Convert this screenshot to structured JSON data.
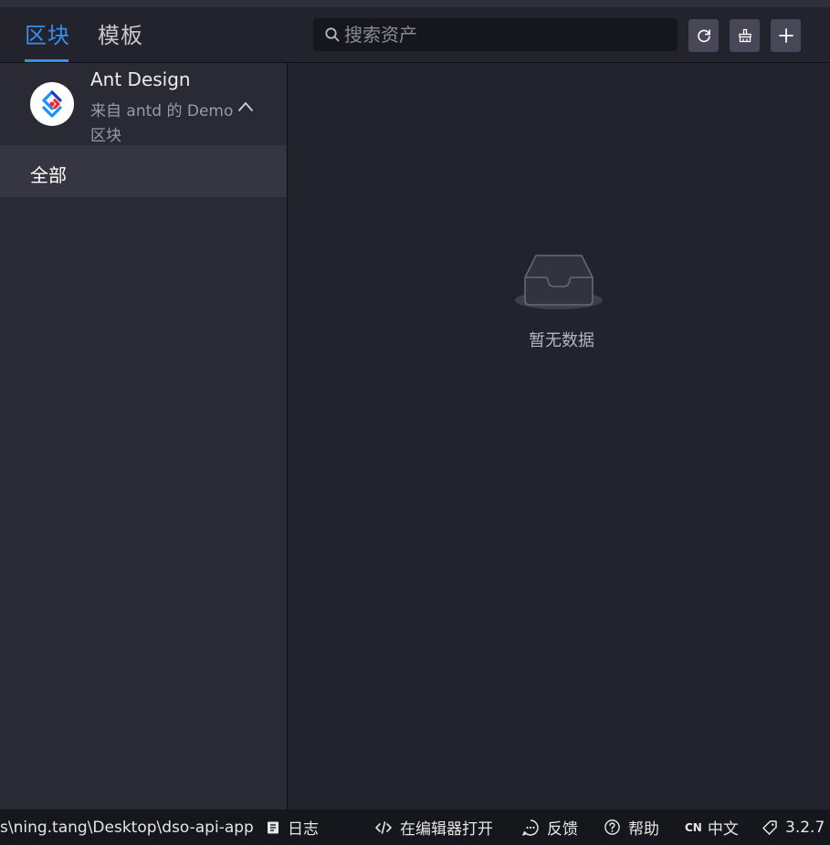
{
  "header": {
    "tabs": [
      {
        "label": "区块",
        "active": true
      },
      {
        "label": "模板",
        "active": false
      }
    ],
    "search": {
      "placeholder": "搜索资产",
      "value": ""
    },
    "buttons": {
      "refresh_icon": "refresh-icon",
      "clean_icon": "broom-icon",
      "add_icon": "plus-icon"
    }
  },
  "sidebar": {
    "source": {
      "title": "Ant Design",
      "description": "来自 antd 的 Demo",
      "type": "区块",
      "logo_icon": "antd-logo-icon"
    },
    "categories": [
      {
        "label": "全部",
        "selected": true
      }
    ]
  },
  "main": {
    "empty_text": "暂无数据",
    "empty_icon": "empty-inbox-icon"
  },
  "statusbar": {
    "path": "s\\ning.tang\\Desktop\\dso-api-app",
    "log": "日志",
    "open_in_editor": "在编辑器打开",
    "feedback": "反馈",
    "help": "帮助",
    "lang_code": "CN",
    "lang": "中文",
    "version": "3.2.7"
  },
  "colors": {
    "accent": "#3c8cf0",
    "background": "#23232d",
    "sidebar": "#2a2a34",
    "statusbar": "#16161d"
  }
}
